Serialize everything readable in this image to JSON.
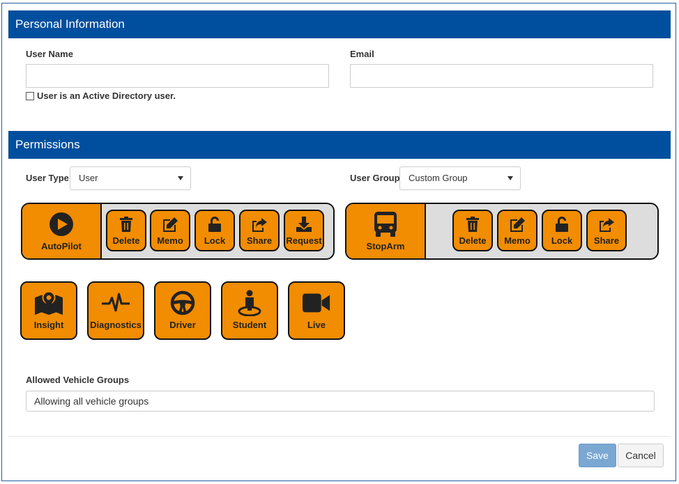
{
  "personal": {
    "title": "Personal Information",
    "username_label": "User Name",
    "username_value": "",
    "email_label": "Email",
    "email_value": "",
    "ad_checkbox_label": "User is an Active Directory user.",
    "ad_checked": false
  },
  "permissions": {
    "title": "Permissions",
    "user_type_label": "User Type",
    "user_type_value": "User",
    "user_group_label": "User Group",
    "user_group_value": "Custom Group",
    "autopilot": {
      "label": "AutoPilot",
      "icon": "play-circle-icon",
      "actions": [
        {
          "label": "Delete",
          "icon": "trash-icon"
        },
        {
          "label": "Memo",
          "icon": "edit-icon"
        },
        {
          "label": "Lock",
          "icon": "unlock-icon"
        },
        {
          "label": "Share",
          "icon": "share-icon"
        },
        {
          "label": "Request",
          "icon": "download-icon"
        }
      ]
    },
    "stoparm": {
      "label": "StopArm",
      "icon": "bus-icon",
      "actions": [
        {
          "label": "Delete",
          "icon": "trash-icon"
        },
        {
          "label": "Memo",
          "icon": "edit-icon"
        },
        {
          "label": "Lock",
          "icon": "unlock-icon"
        },
        {
          "label": "Share",
          "icon": "share-icon"
        }
      ]
    },
    "modules": [
      {
        "label": "Insight",
        "icon": "map-pin-icon"
      },
      {
        "label": "Diagnostics",
        "icon": "pulse-icon"
      },
      {
        "label": "Driver",
        "icon": "steering-wheel-icon"
      },
      {
        "label": "Student",
        "icon": "student-pin-icon"
      },
      {
        "label": "Live",
        "icon": "video-camera-icon"
      }
    ],
    "vehicle_groups_label": "Allowed Vehicle Groups",
    "vehicle_groups_value": "Allowing all vehicle groups"
  },
  "footer": {
    "save_label": "Save",
    "cancel_label": "Cancel"
  },
  "colors": {
    "header_blue": "#004f9e",
    "button_orange": "#f28c00",
    "save_blue": "#7ba7d3"
  }
}
